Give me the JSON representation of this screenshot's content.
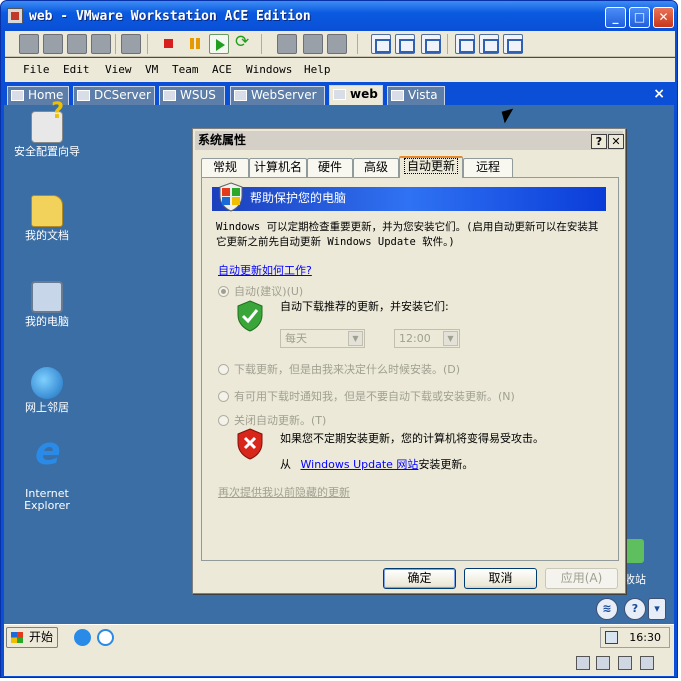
{
  "window": {
    "title": "web - VMware Workstation ACE Edition",
    "minimize": "_",
    "maximize": "□",
    "close": "✕"
  },
  "menu": [
    "File",
    "Edit",
    "View",
    "VM",
    "Team",
    "ACE",
    "Windows",
    "Help"
  ],
  "tabs": [
    {
      "label": "Home"
    },
    {
      "label": "DCServer"
    },
    {
      "label": "WSUS"
    },
    {
      "label": "WebServer"
    },
    {
      "label": "web",
      "active": true
    },
    {
      "label": "Vista"
    }
  ],
  "tab_close": "×",
  "desktop_icons": [
    {
      "label": "安全配置向导",
      "icon": "security-wizard-icon"
    },
    {
      "label": "我的文档",
      "icon": "folder-icon"
    },
    {
      "label": "我的电脑",
      "icon": "computer-icon"
    },
    {
      "label": "网上邻居",
      "icon": "network-icon"
    },
    {
      "label": "Internet Explorer",
      "icon": "ie-icon"
    }
  ],
  "dialog": {
    "title": "系统属性",
    "help_btn": "?",
    "close_btn": "✕",
    "tabs": [
      "常规",
      "计算机名",
      "硬件",
      "高级",
      "自动更新",
      "远程"
    ],
    "active_tab": "自动更新",
    "banner": "帮助保护您的电脑",
    "description": "Windows 可以定期检查重要更新，并为您安装它们。(启用自动更新可以在安装其它更新之前先自动更新 Windows Update 软件。)",
    "how_link": "自动更新如何工作?",
    "options": {
      "auto": "自动(建议)(U)",
      "auto_sub": "自动下载推荐的更新，并安装它们:",
      "day": "每天",
      "time": "12:00",
      "download": "下载更新，但是由我来决定什么时候安装。(D)",
      "notify": "有可用下载时通知我，但是不要自动下载或安装更新。(N)",
      "off": "关闭自动更新。(T)"
    },
    "warning": "如果您不定期安装更新，您的计算机将变得易受攻击。",
    "from_prefix": "从",
    "wu_link": "Windows Update 网站",
    "from_suffix": "安装更新。",
    "hidden_link": "再次提供我以前隐藏的更新",
    "buttons": {
      "ok": "确定",
      "cancel": "取消",
      "apply": "应用(A)"
    }
  },
  "partial_icon_label": "收站",
  "taskbar": {
    "start": "开始",
    "clock": "16:30"
  },
  "helpers": {
    "help": "?"
  }
}
